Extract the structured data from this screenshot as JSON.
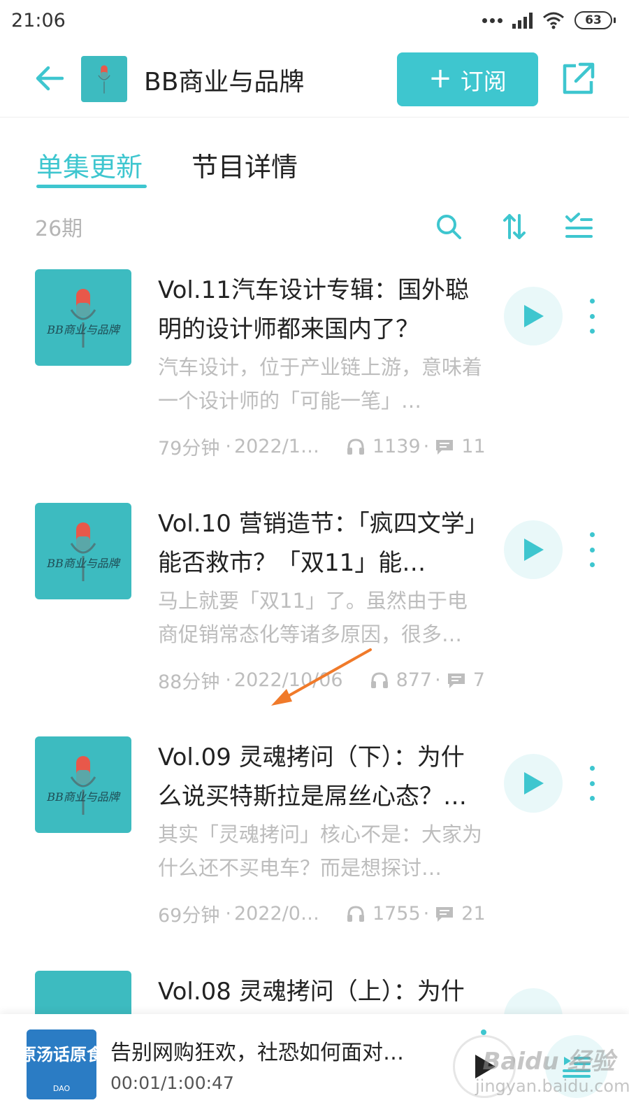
{
  "status_bar": {
    "time": "21:06",
    "battery": "63"
  },
  "header": {
    "title": "BB商业与品牌",
    "subscribe_label": "订阅",
    "cover_text": "BB商业与品牌"
  },
  "tabs": [
    {
      "label": "单集更新",
      "active": true
    },
    {
      "label": "节目详情",
      "active": false
    }
  ],
  "list": {
    "count": "26期"
  },
  "episodes": [
    {
      "title": "Vol.11汽车设计专辑：国外聪明的设计师都来国内了？",
      "desc": "汽车设计，位于产业链上游，意味着一个设计师的「可能一笔」…",
      "duration": "79分钟",
      "date": "2022/1…",
      "plays": "1139",
      "comments": "11",
      "cover_text": "BB商业与品牌"
    },
    {
      "title": "Vol.10 营销造节：「疯四文学」能否救市？「双11」能…",
      "desc": "马上就要「双11」了。虽然由于电商促销常态化等诸多原因，很多…",
      "duration": "88分钟",
      "date": "2022/10/06",
      "plays": "877",
      "comments": "7",
      "cover_text": "BB商业与品牌"
    },
    {
      "title": "Vol.09 灵魂拷问（下）：为什么说买特斯拉是屌丝心态？…",
      "desc": "其实「灵魂拷问」核心不是：大家为什么还不买电车？而是想探讨…",
      "duration": "69分钟",
      "date": "2022/0…",
      "plays": "1755",
      "comments": "21",
      "cover_text": "BB商业与品牌"
    },
    {
      "title": "Vol.08 灵魂拷问（上）：为什",
      "desc": "",
      "duration": "",
      "date": "",
      "plays": "",
      "comments": "",
      "cover_text": ""
    }
  ],
  "mini_player": {
    "title": "告别网购狂欢，社恐如何面对…",
    "time": "00:01/1:00:47",
    "cover_text": "原汤话原食",
    "cover_sub": "DAO"
  },
  "watermark": {
    "brand": "Baidu 经验",
    "url": "jingyan.baidu.com"
  },
  "colors": {
    "accent": "#3ec6cf",
    "cover_teal": "#3dbbc0",
    "arrow": "#f07a2a"
  }
}
